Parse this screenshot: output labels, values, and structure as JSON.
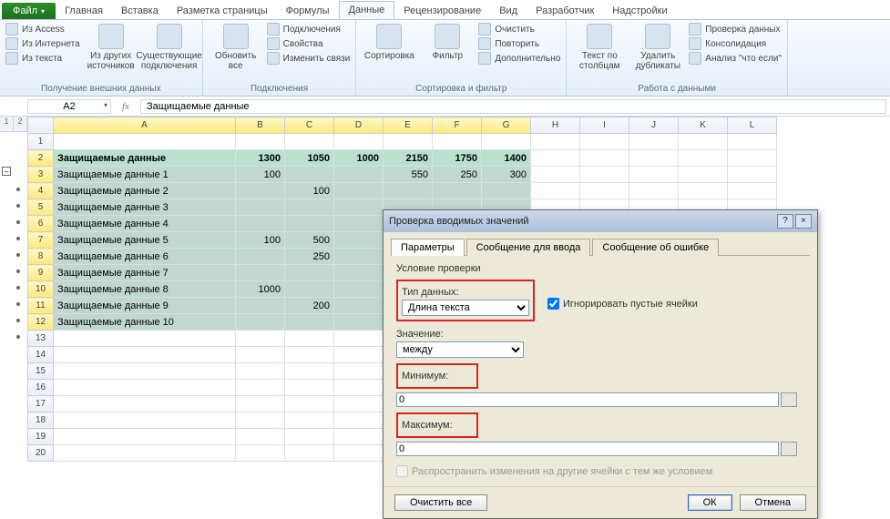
{
  "tabs": {
    "file": "Файл",
    "items": [
      "Главная",
      "Вставка",
      "Разметка страницы",
      "Формулы",
      "Данные",
      "Рецензирование",
      "Вид",
      "Разработчик",
      "Надстройки"
    ],
    "active_index": 4
  },
  "ribbon": {
    "groups": [
      {
        "title": "Получение внешних данных",
        "small": [
          "Из Access",
          "Из Интернета",
          "Из текста"
        ],
        "big": [
          {
            "label": "Из других источников"
          },
          {
            "label": "Существующие подключения"
          }
        ]
      },
      {
        "title": "Подключения",
        "big": [
          {
            "label": "Обновить все"
          }
        ],
        "small": [
          "Подключения",
          "Свойства",
          "Изменить связи"
        ]
      },
      {
        "title": "Сортировка и фильтр",
        "big": [
          {
            "label": "Сортировка"
          },
          {
            "label": "Фильтр"
          }
        ],
        "small": [
          "Очистить",
          "Повторить",
          "Дополнительно"
        ]
      },
      {
        "title": "Работа с данными",
        "big": [
          {
            "label": "Текст по столбцам"
          },
          {
            "label": "Удалить дубликаты"
          }
        ],
        "small": [
          "Проверка данных",
          "Консолидация",
          "Анализ \"что если\""
        ]
      }
    ]
  },
  "formula_bar": {
    "cell": "A2",
    "value": "Защищаемые данные"
  },
  "outline": {
    "levels": [
      "1",
      "2"
    ],
    "collapse_glyph": "–"
  },
  "columns": [
    "A",
    "B",
    "C",
    "D",
    "E",
    "F",
    "G",
    "H",
    "I",
    "J",
    "K",
    "L"
  ],
  "rows": [
    {
      "n": 1,
      "cells": [
        "",
        "",
        "",
        "",
        "",
        "",
        "",
        "",
        "",
        "",
        "",
        ""
      ]
    },
    {
      "n": 2,
      "cells": [
        "Защищаемые данные",
        "1300",
        "1050",
        "1000",
        "2150",
        "1750",
        "1400",
        "",
        "",
        "",
        "",
        ""
      ]
    },
    {
      "n": 3,
      "cells": [
        "Защищаемые данные 1",
        "100",
        "",
        "",
        "550",
        "250",
        "300",
        "",
        "",
        "",
        "",
        ""
      ]
    },
    {
      "n": 4,
      "cells": [
        "Защищаемые данные 2",
        "",
        "100",
        "",
        "",
        "",
        "",
        "",
        "",
        "",
        "",
        ""
      ]
    },
    {
      "n": 5,
      "cells": [
        "Защищаемые данные 3",
        "",
        "",
        "",
        "",
        "",
        "",
        "",
        "",
        "",
        "",
        ""
      ]
    },
    {
      "n": 6,
      "cells": [
        "Защищаемые данные 4",
        "",
        "",
        "",
        "",
        "",
        "",
        "",
        "",
        "",
        "",
        ""
      ]
    },
    {
      "n": 7,
      "cells": [
        "Защищаемые данные 5",
        "100",
        "500",
        "",
        "",
        "",
        "",
        "",
        "",
        "",
        "",
        ""
      ]
    },
    {
      "n": 8,
      "cells": [
        "Защищаемые данные 6",
        "",
        "250",
        "",
        "",
        "",
        "",
        "",
        "",
        "",
        "",
        ""
      ]
    },
    {
      "n": 9,
      "cells": [
        "Защищаемые данные 7",
        "",
        "",
        "",
        "",
        "",
        "",
        "",
        "",
        "",
        "",
        ""
      ]
    },
    {
      "n": 10,
      "cells": [
        "Защищаемые данные 8",
        "1000",
        "",
        "",
        "",
        "",
        "",
        "",
        "",
        "",
        "",
        ""
      ]
    },
    {
      "n": 11,
      "cells": [
        "Защищаемые данные 9",
        "",
        "200",
        "",
        "",
        "",
        "",
        "",
        "",
        "",
        "",
        ""
      ]
    },
    {
      "n": 12,
      "cells": [
        "Защищаемые данные 10",
        "",
        "",
        "",
        "",
        "",
        "",
        "",
        "",
        "",
        "",
        ""
      ]
    },
    {
      "n": 13,
      "cells": [
        "",
        "",
        "",
        "",
        "",
        "",
        "",
        "",
        "",
        "",
        "",
        ""
      ]
    },
    {
      "n": 14,
      "cells": [
        "",
        "",
        "",
        "",
        "",
        "",
        "",
        "",
        "",
        "",
        "",
        ""
      ]
    },
    {
      "n": 15,
      "cells": [
        "",
        "",
        "",
        "",
        "",
        "",
        "",
        "",
        "",
        "",
        "",
        ""
      ]
    },
    {
      "n": 16,
      "cells": [
        "",
        "",
        "",
        "",
        "",
        "",
        "",
        "",
        "",
        "",
        "",
        ""
      ]
    },
    {
      "n": 17,
      "cells": [
        "",
        "",
        "",
        "",
        "",
        "",
        "",
        "",
        "",
        "",
        "",
        ""
      ]
    },
    {
      "n": 18,
      "cells": [
        "",
        "",
        "",
        "",
        "",
        "",
        "",
        "",
        "",
        "",
        "",
        ""
      ]
    },
    {
      "n": 19,
      "cells": [
        "",
        "",
        "",
        "",
        "",
        "",
        "",
        "",
        "",
        "",
        "",
        ""
      ]
    },
    {
      "n": 20,
      "cells": [
        "",
        "",
        "",
        "",
        "",
        "",
        "",
        "",
        "",
        "",
        "",
        ""
      ]
    }
  ],
  "selection": {
    "first_row": 2,
    "last_row": 12,
    "first_col": 0,
    "last_col": 6
  },
  "dialog": {
    "title": "Проверка вводимых значений",
    "help_glyph": "?",
    "close_glyph": "×",
    "tabs": [
      "Параметры",
      "Сообщение для ввода",
      "Сообщение об ошибке"
    ],
    "active_tab": 0,
    "section_title": "Условие проверки",
    "type_label": "Тип данных:",
    "type_value": "Длина текста",
    "ignore_blank_label": "Игнорировать пустые ячейки",
    "ignore_blank_checked": true,
    "value_label": "Значение:",
    "value_value": "между",
    "min_label": "Минимум:",
    "min_value": "0",
    "max_label": "Максимум:",
    "max_value": "0",
    "propagate_label": "Распространить изменения на другие ячейки с тем же условием",
    "clear_btn": "Очистить все",
    "ok_btn": "ОК",
    "cancel_btn": "Отмена"
  }
}
